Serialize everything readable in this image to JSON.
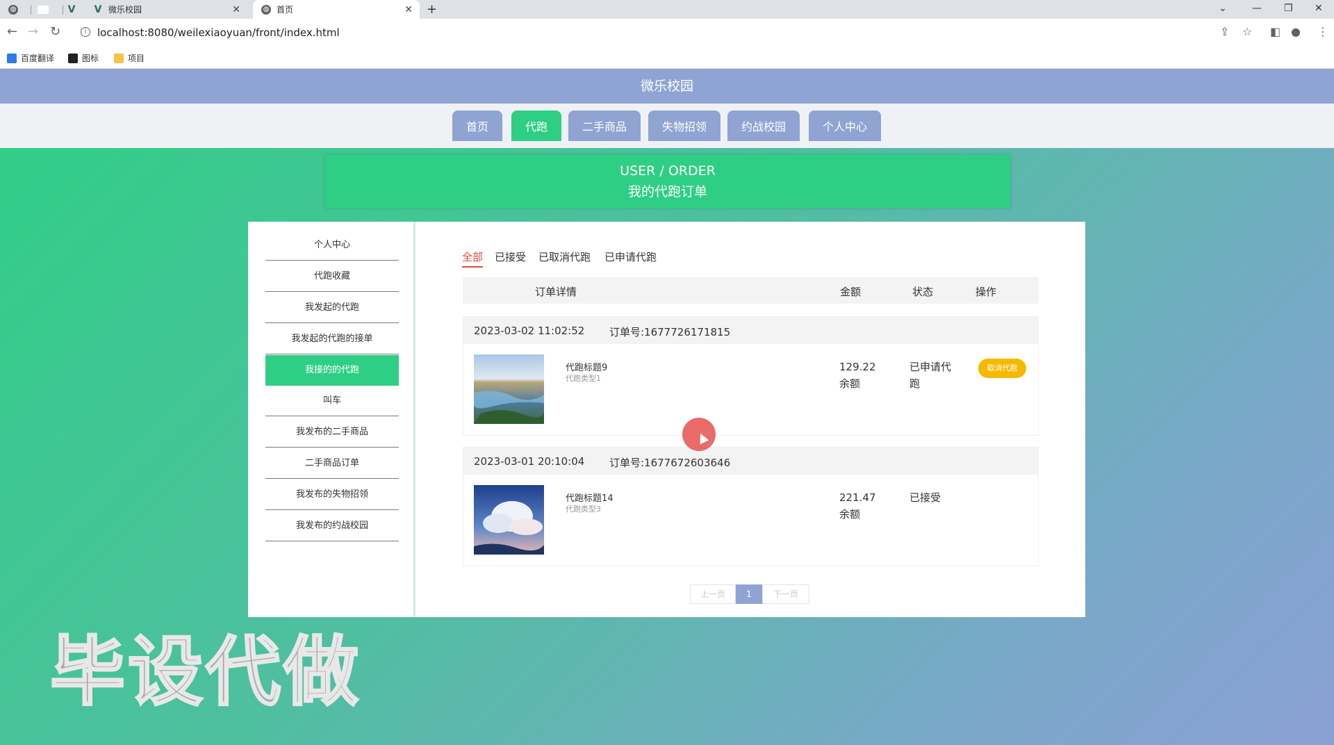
{
  "browser": {
    "tabs": [
      {
        "title": ""
      },
      {
        "title": ""
      },
      {
        "title": ""
      },
      {
        "title": "微乐校园"
      },
      {
        "title": "首页"
      }
    ],
    "new_tab": "+",
    "url": "localhost:8080/weilexiaoyuan/front/index.html",
    "bookmarks": [
      "百度翻译",
      "图标",
      "项目"
    ]
  },
  "site": {
    "title": "微乐校园",
    "menu": [
      "首页",
      "代跑",
      "二手商品",
      "失物招领",
      "约战校园",
      "个人中心"
    ],
    "active_menu": "代跑"
  },
  "banner": {
    "en": "USER / ORDER",
    "cn": "我的代跑订单"
  },
  "sidebar": {
    "items": [
      "个人中心",
      "代跑收藏",
      "我发起的代跑",
      "我发起的代跑的接单",
      "我接的的代跑",
      "叫车",
      "我发布的二手商品",
      "二手商品订单",
      "我发布的失物招领",
      "我发布的约战校园"
    ],
    "active": "我接的的代跑"
  },
  "filter_tabs": [
    "全部",
    "已接受",
    "已取消代跑",
    "已申请代跑"
  ],
  "table_headers": {
    "detail": "订单详情",
    "amount": "金额",
    "status": "状态",
    "action": "操作"
  },
  "orders": [
    {
      "time": "2023-03-02 11:02:52",
      "order_no": "订单号:1677726171815",
      "title": "代跑标题9",
      "type": "代跑类型1",
      "amount": "129.22",
      "pay": "余额",
      "status": "已申请代跑",
      "action": "取消代跑"
    },
    {
      "time": "2023-03-01 20:10:04",
      "order_no": "订单号:1677672603646",
      "title": "代跑标题14",
      "type": "代跑类型3",
      "amount": "221.47",
      "pay": "余额",
      "status": "已接受",
      "action": ""
    }
  ],
  "pager": {
    "prev": "上一页",
    "current": "1",
    "next": "下一页"
  },
  "watermark": "毕设代做",
  "colors": {
    "accent": "#2ecf85",
    "header": "#8fa4d2",
    "cancel": "#f7b800"
  }
}
